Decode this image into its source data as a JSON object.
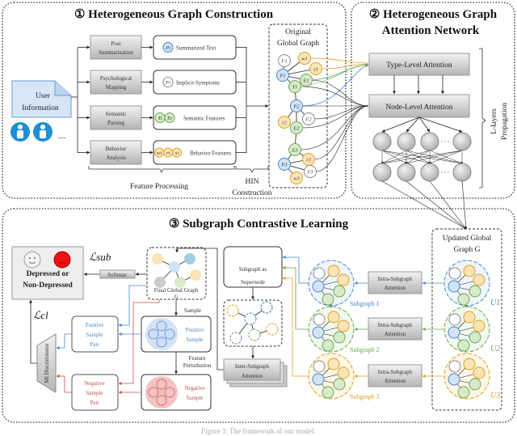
{
  "panel1": {
    "title": "① Heterogeneous Graph Construction",
    "user_info": [
      "User",
      "Information"
    ],
    "ellipsis": "....",
    "steps": [
      {
        "label": [
          "Post",
          "Summarization"
        ],
        "feature": "Summarized Text",
        "nodes": [
          "Pi"
        ]
      },
      {
        "label": [
          "Psychological",
          "Mapping"
        ],
        "feature": "Implicit Symptoms",
        "nodes": [
          "Fi"
        ]
      },
      {
        "label": [
          "Semantic",
          "Parsing"
        ],
        "feature": "Semantic Features",
        "nodes": [
          "Ti",
          "Ei"
        ]
      },
      {
        "label": [
          "Behavior",
          "Analysis"
        ],
        "feature": "Behavior Features",
        "nodes": [
          "wi",
          "ri",
          "si"
        ]
      }
    ],
    "feature_processing": "Feature Processing",
    "hin_construction": [
      "HIN",
      "Construction"
    ],
    "original_graph": [
      "Original",
      "Global Graph"
    ],
    "graph_nodes": [
      "F1",
      "w1",
      "s1",
      "P1",
      "E1",
      "T1",
      "P2",
      "r2",
      "F2",
      "E2",
      "E3",
      "r3",
      "P3",
      "F3",
      "w3"
    ]
  },
  "panel2": {
    "title": [
      "② Heterogeneous Graph",
      "Attention Network"
    ],
    "type_level": "Type-Level Attention",
    "node_level": "Node-Level Attention",
    "propagation": [
      "L-layers",
      "Propagation"
    ]
  },
  "panel3": {
    "title": "③ Subgraph Contrastive Learning",
    "updated_graph": [
      "Updated Global",
      "Graph G"
    ],
    "u_labels": [
      "U1",
      "U2",
      "U3"
    ],
    "intra_attention": [
      "Intra-Subgraph",
      "Attention"
    ],
    "subgraph_labels": [
      "Subgraph 1",
      "Subgraph 2",
      "Subgraph 3"
    ],
    "supernode": [
      "Subgraph as",
      "Supernode"
    ],
    "inter_attention": [
      "Inter-Subgraph",
      "Attention"
    ],
    "final_graph": [
      "Final Global Graph",
      "G"
    ],
    "softmax": "Softmax",
    "output": [
      "Depressed or",
      "Non-Depressed"
    ],
    "loss_sub": "ℒsub",
    "loss_cl": "ℒcl",
    "sample": "Sample",
    "feature_perturbation": [
      "Feature",
      "Perturbation"
    ],
    "positive_sample": [
      "Positive",
      "Sample"
    ],
    "negative_sample": [
      "Negative",
      "Sample"
    ],
    "positive_pair": [
      "Positive",
      "Sample",
      "Pair"
    ],
    "negative_pair": [
      "Negative",
      "Sample",
      "Pair"
    ],
    "discriminator": "MI Discriminator"
  },
  "caption": "Figure 1: The framework of our model.",
  "colors": {
    "post": "#4a86c8",
    "post_fill": "#d3e3f6",
    "behavior": "#e0a020",
    "behavior_fill": "#fbe5b6",
    "semantic": "#6aa84f",
    "semantic_fill": "#d7eacb",
    "symptom": "#888888",
    "positive": "#4a86c8",
    "negative": "#c0504d"
  }
}
